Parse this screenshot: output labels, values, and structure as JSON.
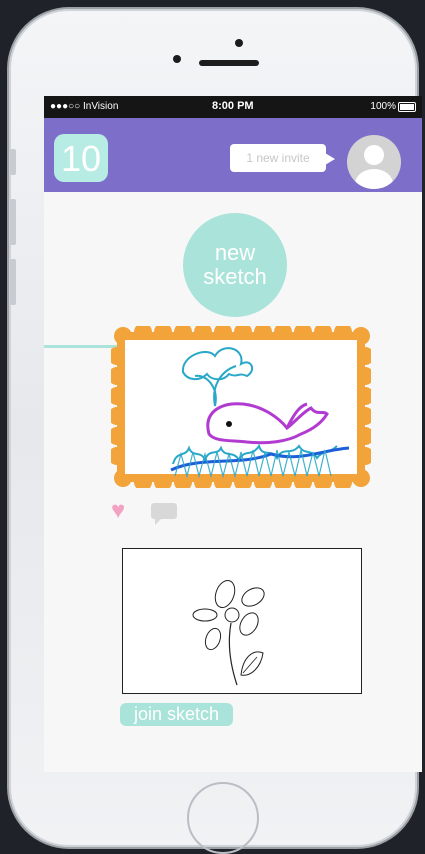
{
  "status_bar": {
    "carrier": "●●●○○ InVision",
    "time": "8:00 PM",
    "battery": "100%"
  },
  "header": {
    "counter": "10",
    "invite_text": "1 new invite"
  },
  "main": {
    "new_sketch_label": "new\nsketch",
    "join_sketch_label": "join sketch"
  },
  "colors": {
    "header_bg": "#7d6fc9",
    "accent_mint": "#a9e3da",
    "frame_orange": "#f2a33a",
    "heart_pink": "#f2a3c3"
  },
  "icons": {
    "wifi": "wifi-icon",
    "battery": "battery-icon",
    "heart": "heart-icon",
    "comment": "comment-icon",
    "avatar": "avatar-icon"
  }
}
